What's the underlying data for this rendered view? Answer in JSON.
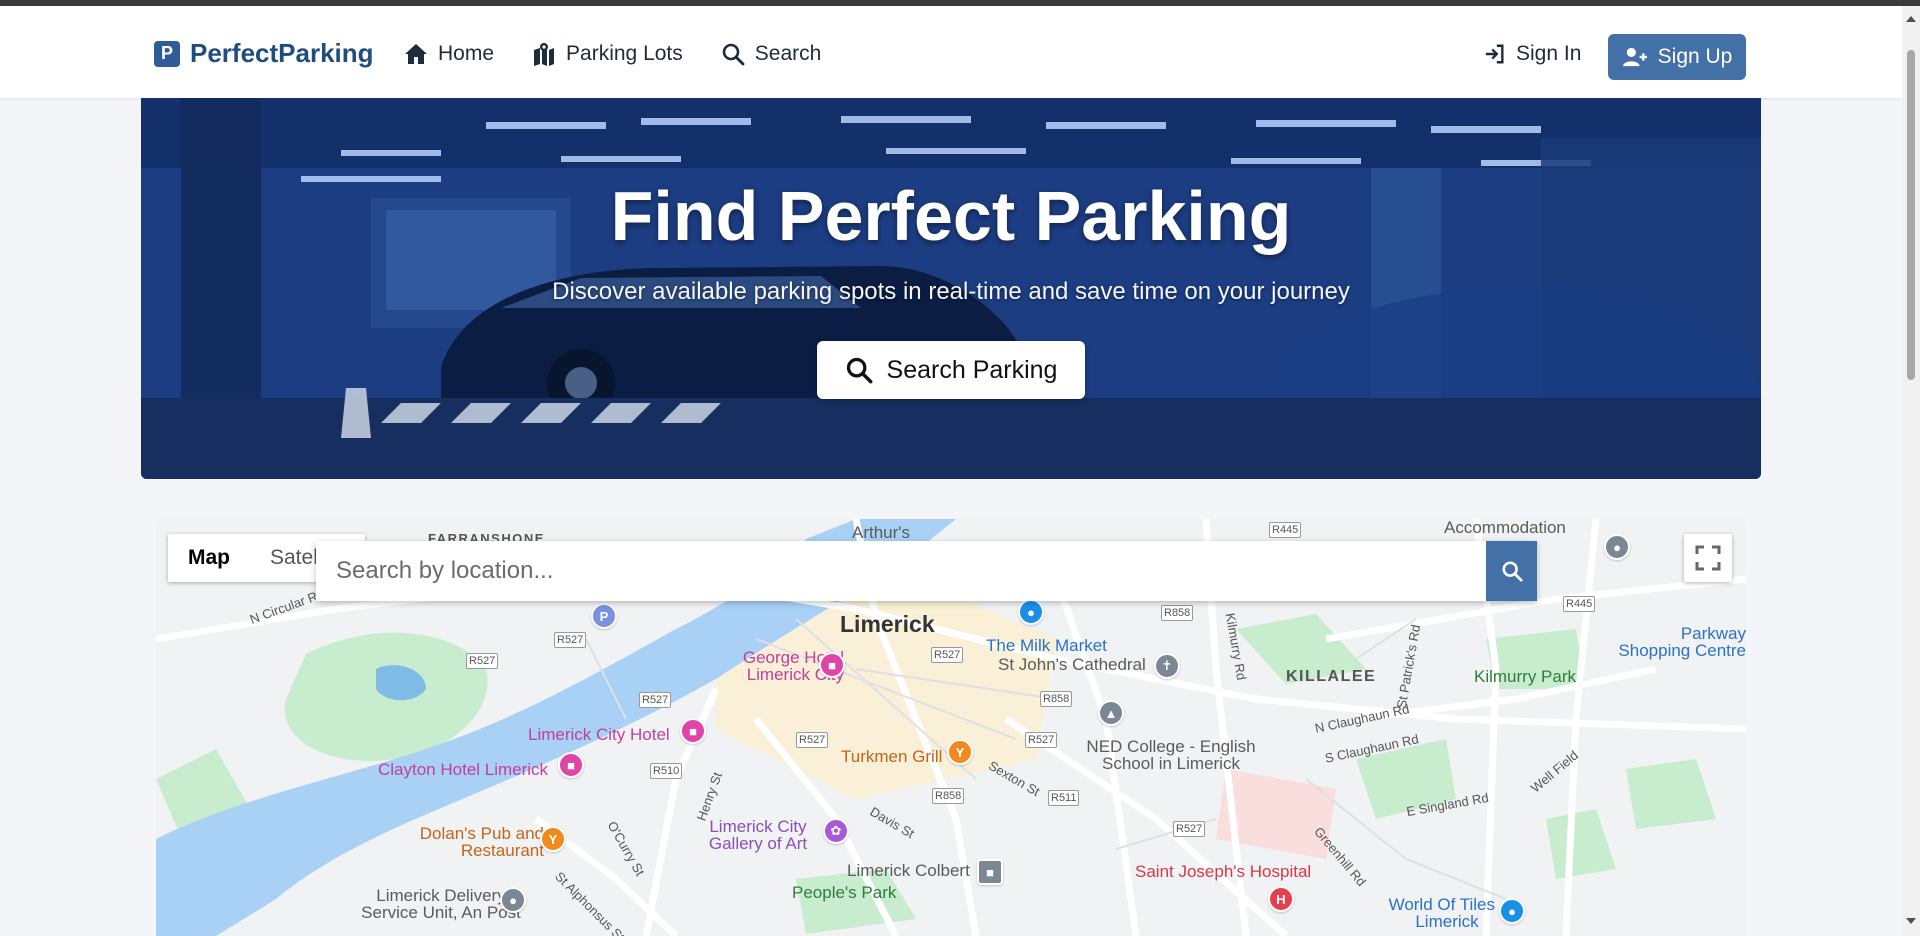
{
  "brand": {
    "name": "PerfectParking",
    "logo_letter": "P"
  },
  "nav": [
    {
      "label": "Home",
      "icon": "home-icon"
    },
    {
      "label": "Parking Lots",
      "icon": "map-marked-icon"
    },
    {
      "label": "Search",
      "icon": "search-icon"
    }
  ],
  "auth": {
    "sign_in": "Sign In",
    "sign_up": "Sign Up"
  },
  "hero": {
    "title": "Find Perfect Parking",
    "subtitle": "Discover available parking spots in real-time and save time on your journey",
    "button": "Search Parking"
  },
  "map": {
    "type_options": [
      "Map",
      "Satellite"
    ],
    "active_type": "Map",
    "search_placeholder": "Search by location...",
    "labels": {
      "city": "Limerick",
      "milk_market": "The Milk Market",
      "cathedral": "St John's Cathedral",
      "george_hotel": "George Hotel Limerick City",
      "city_hotel": "Limerick City Hotel",
      "clayton": "Clayton Hotel Limerick",
      "dolans": "Dolan's Pub and Restaurant",
      "gallery": "Limerick City Gallery of Art",
      "turkmen": "Turkmen Grill",
      "ned": "NED College - English School in Limerick",
      "colbert": "Limerick Colbert",
      "peoples_park": "People's Park",
      "st_josephs": "Saint Joseph's Hospital",
      "world_of_tiles": "World Of Tiles - Limerick",
      "delivery": "Limerick Delivery Service Unit, An Post",
      "killalee": "KILLALEE",
      "kilmurry_park": "Kilmurry Park",
      "parkway": "Parkway Shopping Centre",
      "arthurs": "Arthur's",
      "farranshone": "FARRANSHONE",
      "accommodation": "Accommodation",
      "n_circular": "N Circular Rd",
      "n_claughaun": "N Claughaun Rd",
      "s_claughaun": "S Claughaun Rd",
      "e_singland": "E Singland Rd",
      "well_field": "Well Field",
      "greenhill": "Greenhill Rd",
      "sexton": "Sexton St",
      "davis": "Davis St",
      "henry": "Henry St",
      "ocurry": "O'Curry St",
      "alphonsus": "St Alphonsus St",
      "kilmurry_rd": "Kilmurry Rd",
      "st_patricks": "St Patrick's Rd"
    },
    "shields": [
      "R445",
      "R858",
      "R527",
      "R510",
      "R511"
    ]
  },
  "colors": {
    "accent": "#4470a8",
    "brand": "#1f4e7e",
    "hero_tint": "#1d3f82"
  }
}
